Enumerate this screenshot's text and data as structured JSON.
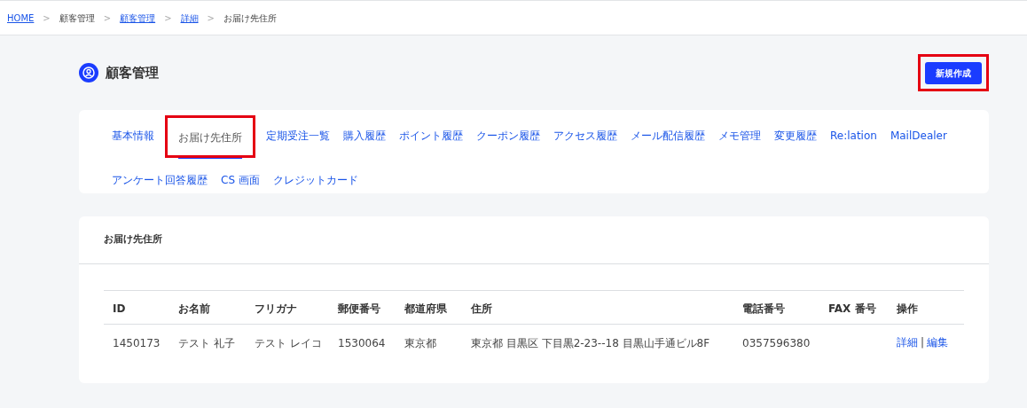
{
  "breadcrumb": {
    "separator": ">",
    "items": [
      {
        "label": "HOME",
        "link": true
      },
      {
        "label": "顧客管理",
        "link": false
      },
      {
        "label": "顧客管理",
        "link": true
      },
      {
        "label": "詳細",
        "link": true
      },
      {
        "label": "お届け先住所",
        "link": false
      }
    ]
  },
  "page_title": "顧客管理",
  "new_button": {
    "label": "新規作成",
    "highlighted": true
  },
  "tabs": [
    {
      "label": "基本情報",
      "selected": false,
      "highlighted": false
    },
    {
      "label": "お届け先住所",
      "selected": true,
      "highlighted": true
    },
    {
      "label": "定期受注一覧",
      "selected": false,
      "highlighted": false
    },
    {
      "label": "購入履歴",
      "selected": false,
      "highlighted": false
    },
    {
      "label": "ポイント履歴",
      "selected": false,
      "highlighted": false
    },
    {
      "label": "クーポン履歴",
      "selected": false,
      "highlighted": false
    },
    {
      "label": "アクセス履歴",
      "selected": false,
      "highlighted": false
    },
    {
      "label": "メール配信履歴",
      "selected": false,
      "highlighted": false
    },
    {
      "label": "メモ管理",
      "selected": false,
      "highlighted": false
    },
    {
      "label": "変更履歴",
      "selected": false,
      "highlighted": false
    },
    {
      "label": "Re:lation",
      "selected": false,
      "highlighted": false
    },
    {
      "label": "MailDealer",
      "selected": false,
      "highlighted": false
    },
    {
      "label": "アンケート回答履歴",
      "selected": false,
      "highlighted": false
    },
    {
      "label": "CS 画面",
      "selected": false,
      "highlighted": false
    },
    {
      "label": "クレジットカード",
      "selected": false,
      "highlighted": false
    }
  ],
  "section_title": "お届け先住所",
  "table": {
    "columns": [
      "ID",
      "お名前",
      "フリガナ",
      "郵便番号",
      "都道府県",
      "住所",
      "電話番号",
      "FAX 番号",
      "操作"
    ],
    "rows": [
      {
        "cells": [
          "1450173",
          "テスト 礼子",
          "テスト レイコ",
          "1530064",
          "東京都",
          "東京都 目黒区 下目黒2-23--18 目黒山手通ビル8F",
          "0357596380",
          ""
        ],
        "actions": [
          "詳細",
          "編集"
        ],
        "action_separator": "|"
      }
    ]
  }
}
